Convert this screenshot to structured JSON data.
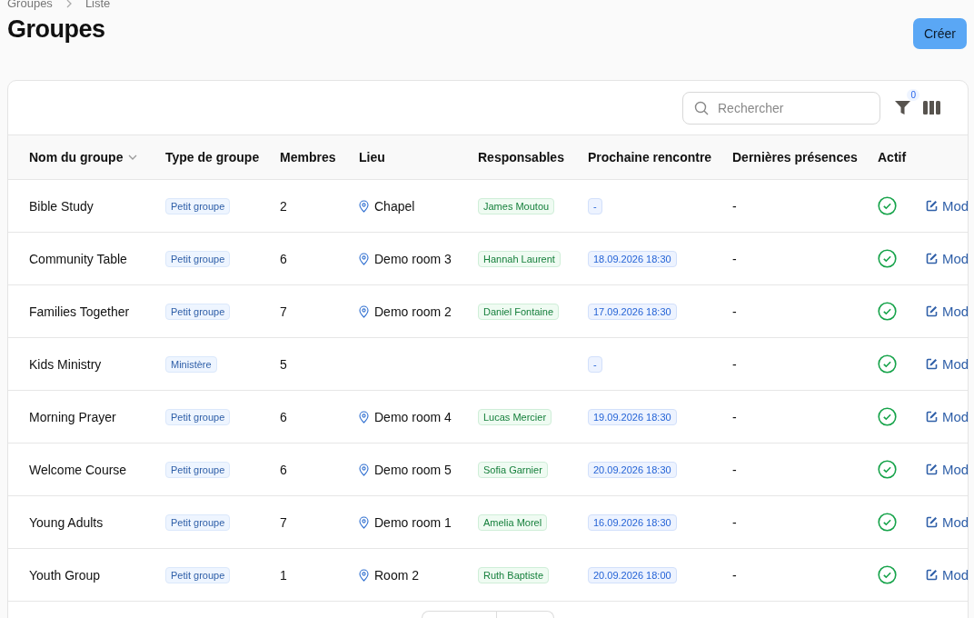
{
  "breadcrumb": [
    "Groupes",
    "Liste"
  ],
  "title": "Groupes",
  "create_button": "Créer",
  "search": {
    "placeholder": "Rechercher"
  },
  "filter_count": "0",
  "columns": [
    {
      "label": "Nom du groupe",
      "sortable": true
    },
    {
      "label": "Type de groupe",
      "sortable": false
    },
    {
      "label": "Membres",
      "sortable": false
    },
    {
      "label": "Lieu",
      "sortable": false
    },
    {
      "label": "Responsables",
      "sortable": false
    },
    {
      "label": "Prochaine rencontre",
      "sortable": false
    },
    {
      "label": "Dernières présences",
      "sortable": false
    },
    {
      "label": "Actif",
      "sortable": false
    }
  ],
  "rows": [
    {
      "name": "Bible Study",
      "type": "Petit groupe",
      "members": "2",
      "place": "Chapel",
      "leader": "James Moutou",
      "next": "-",
      "last": "-",
      "active": true,
      "action": "Mod"
    },
    {
      "name": "Community Table",
      "type": "Petit groupe",
      "members": "6",
      "place": "Demo room 3",
      "leader": "Hannah Laurent",
      "next": "18.09.2026 18:30",
      "last": "-",
      "active": true,
      "action": "Mod"
    },
    {
      "name": "Families Together",
      "type": "Petit groupe",
      "members": "7",
      "place": "Demo room 2",
      "leader": "Daniel Fontaine",
      "next": "17.09.2026 18:30",
      "last": "-",
      "active": true,
      "action": "Mod"
    },
    {
      "name": "Kids Ministry",
      "type": "Ministère",
      "members": "5",
      "next": "-",
      "last": "-",
      "active": true,
      "action": "Mod"
    },
    {
      "name": "Morning Prayer",
      "type": "Petit groupe",
      "members": "6",
      "place": "Demo room 4",
      "leader": "Lucas Mercier",
      "next": "19.09.2026 18:30",
      "last": "-",
      "active": true,
      "action": "Mod"
    },
    {
      "name": "Welcome Course",
      "type": "Petit groupe",
      "members": "6",
      "place": "Demo room 5",
      "leader": "Sofia Garnier",
      "next": "20.09.2026 18:30",
      "last": "-",
      "active": true,
      "action": "Mod"
    },
    {
      "name": "Young Adults",
      "type": "Petit groupe",
      "members": "7",
      "place": "Demo room 1",
      "leader": "Amelia Morel",
      "next": "16.09.2026 18:30",
      "last": "-",
      "active": true,
      "action": "Mod"
    },
    {
      "name": "Youth Group",
      "type": "Petit groupe",
      "members": "1",
      "place": "Room 2",
      "leader": "Ruth Baptiste",
      "next": "20.09.2026 18:00",
      "last": "-",
      "active": true,
      "action": "Mod"
    }
  ]
}
